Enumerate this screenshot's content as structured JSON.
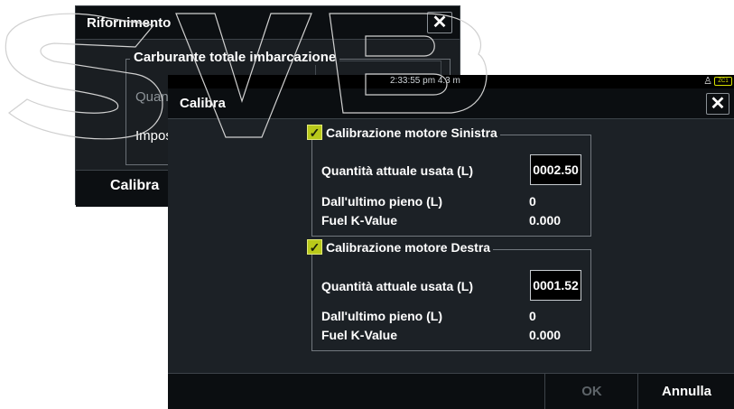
{
  "background_dialog": {
    "title": "Rifornimento",
    "close_icon": "close-icon",
    "section_label": "Carburante totale imbarcazione",
    "row1_label": "Quant",
    "row2_label": "Impos",
    "calibra_button": "Calibra"
  },
  "status_bar": {
    "time": "2:33:55 pm   4.3 m",
    "person_icon": "person-icon",
    "badge": "ZC1"
  },
  "dialog": {
    "title": "Calibra",
    "close_icon": "close-icon",
    "groups": [
      {
        "label": "Calibrazione motore Sinistra",
        "checked": true,
        "rows": [
          {
            "label": "Quantità attuale usata (L)",
            "value": "0002.50"
          },
          {
            "label": "Dall'ultimo pieno (L)",
            "value": "0"
          },
          {
            "label": "Fuel K-Value",
            "value": "0.000"
          }
        ]
      },
      {
        "label": "Calibrazione motore Destra",
        "checked": true,
        "rows": [
          {
            "label": "Quantità attuale usata (L)",
            "value": "0001.52"
          },
          {
            "label": "Dall'ultimo pieno (L)",
            "value": "0"
          },
          {
            "label": "Fuel K-Value",
            "value": "0.000"
          }
        ]
      }
    ],
    "ok_button": "OK",
    "cancel_button": "Annulla"
  },
  "colors": {
    "accent_check": "#b9c91a",
    "badge": "#d8e000",
    "dialog_bg": "#1c2126",
    "bar_bg": "#0b0e11"
  }
}
